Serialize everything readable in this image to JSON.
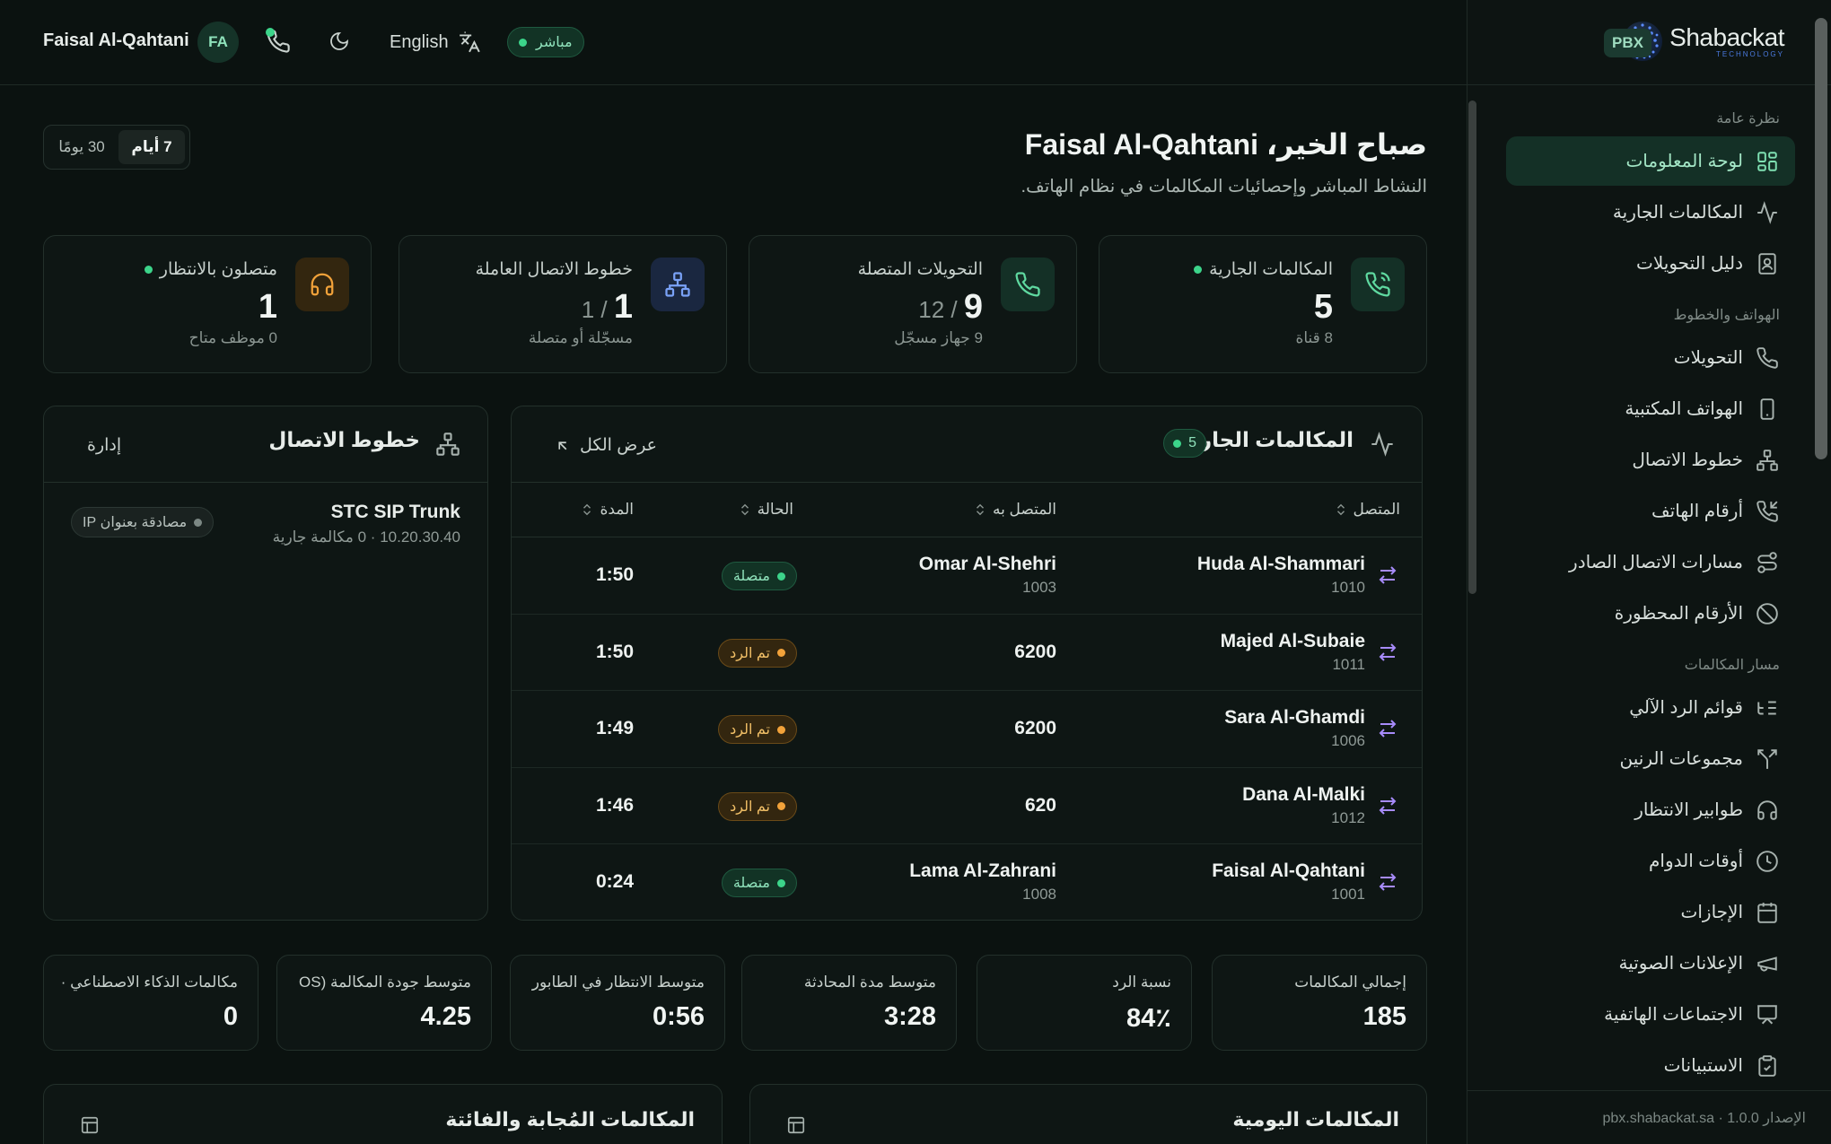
{
  "brand": {
    "name": "Shabackat",
    "sub": "TECHNOLOGY",
    "pbx": "PBX"
  },
  "topbar": {
    "user": "Faisal Al-Qahtani",
    "initials": "FA",
    "language": "English",
    "live": "مباشر"
  },
  "heading": {
    "greeting": "صباح الخير، Faisal Al-Qahtani",
    "subtitle": "النشاط المباشر وإحصائيات المكالمات في نظام الهاتف."
  },
  "range": {
    "opt7": "7 أيام",
    "opt30": "30 يومًا"
  },
  "sidebar": {
    "sections": [
      "نظرة عامة",
      "الهواتف والخطوط",
      "مسار المكالمات"
    ],
    "items": [
      {
        "label": "لوحة المعلومات",
        "icon": "dashboard-icon"
      },
      {
        "label": "المكالمات الجارية",
        "icon": "activity-icon"
      },
      {
        "label": "دليل التحويلات",
        "icon": "contacts-icon"
      },
      {
        "label": "التحويلات",
        "icon": "phone-icon"
      },
      {
        "label": "الهواتف المكتبية",
        "icon": "device-icon"
      },
      {
        "label": "خطوط الاتصال",
        "icon": "network-icon"
      },
      {
        "label": "أرقام الهاتف",
        "icon": "incoming-call-icon"
      },
      {
        "label": "مسارات الاتصال الصادر",
        "icon": "route-icon"
      },
      {
        "label": "الأرقام المحظورة",
        "icon": "blocked-icon"
      },
      {
        "label": "قوائم الرد الآلي",
        "icon": "ivr-icon"
      },
      {
        "label": "مجموعات الرنين",
        "icon": "split-icon"
      },
      {
        "label": "طوابير الانتظار",
        "icon": "headset-icon"
      },
      {
        "label": "أوقات الدوام",
        "icon": "clock-icon"
      },
      {
        "label": "الإجازات",
        "icon": "calendar-icon"
      },
      {
        "label": "الإعلانات الصوتية",
        "icon": "megaphone-icon"
      },
      {
        "label": "الاجتماعات الهاتفية",
        "icon": "presentation-icon"
      },
      {
        "label": "الاستبيانات",
        "icon": "clipboard-icon"
      }
    ],
    "footer": "الإصدار 1.0.0 · pbx.shabackat.sa"
  },
  "stats": [
    {
      "label": "المكالمات الجارية",
      "value": "5",
      "of": "",
      "sub": "8 قناة",
      "live": true,
      "color": "#3cd48a"
    },
    {
      "label": "التحويلات المتصلة",
      "value": "9",
      "of": "12",
      "sub": "9 جهاز مسجّل",
      "live": false,
      "color": "#3cd48a"
    },
    {
      "label": "خطوط الاتصال العاملة",
      "value": "1",
      "of": "1",
      "sub": "مسجّلة أو متصلة",
      "live": false,
      "color": "#7aa2f7"
    },
    {
      "label": "متصلون بالانتظار",
      "value": "1",
      "of": "",
      "sub": "0 موظف متاح",
      "live": true,
      "color": "#f2a23a"
    }
  ],
  "calls": {
    "title": "المكالمات الجارية",
    "count": "5",
    "view_all": "عرض الكل",
    "columns": {
      "caller": "المتصل",
      "callee": "المتصل به",
      "status": "الحالة",
      "duration": "المدة"
    },
    "rows": [
      {
        "caller": "Huda Al-Shammari",
        "caller_ext": "1010",
        "callee": "Omar Al-Shehri",
        "callee_ext": "1003",
        "status": "متصلة",
        "kind": "ok",
        "duration": "1:50"
      },
      {
        "caller": "Majed Al-Subaie",
        "caller_ext": "1011",
        "callee": "6200",
        "callee_ext": "",
        "status": "تم الرد",
        "kind": "ans",
        "duration": "1:50"
      },
      {
        "caller": "Sara Al-Ghamdi",
        "caller_ext": "1006",
        "callee": "6200",
        "callee_ext": "",
        "status": "تم الرد",
        "kind": "ans",
        "duration": "1:49"
      },
      {
        "caller": "Dana Al-Malki",
        "caller_ext": "1012",
        "callee": "620",
        "callee_ext": "",
        "status": "تم الرد",
        "kind": "ans",
        "duration": "1:46"
      },
      {
        "caller": "Faisal Al-Qahtani",
        "caller_ext": "1001",
        "callee": "Lama Al-Zahrani",
        "callee_ext": "1008",
        "status": "متصلة",
        "kind": "ok",
        "duration": "0:24"
      }
    ]
  },
  "trunks": {
    "title": "خطوط الاتصال",
    "manage": "إدارة",
    "items": [
      {
        "name": "STC SIP Trunk",
        "sub": "10.20.30.40 · 0 مكالمة جارية",
        "badge": "مصادقة بعنوان IP"
      }
    ]
  },
  "metrics": [
    {
      "label": "إجمالي المكالمات",
      "value": "185"
    },
    {
      "label": "نسبة الرد",
      "value": "84٪"
    },
    {
      "label": "متوسط مدة المحادثة",
      "value": "3:28"
    },
    {
      "label": "متوسط الانتظار في الطابور",
      "value": "0:56"
    },
    {
      "label": "متوسط جودة المكالمة (OS",
      "value": "4.25"
    },
    {
      "label": "مكالمات الذكاء الاصطناعي ·",
      "value": "0"
    }
  ],
  "bottom": {
    "daily": "المكالمات اليومية",
    "answered": "المكالمات المُجابة والفائتة"
  }
}
